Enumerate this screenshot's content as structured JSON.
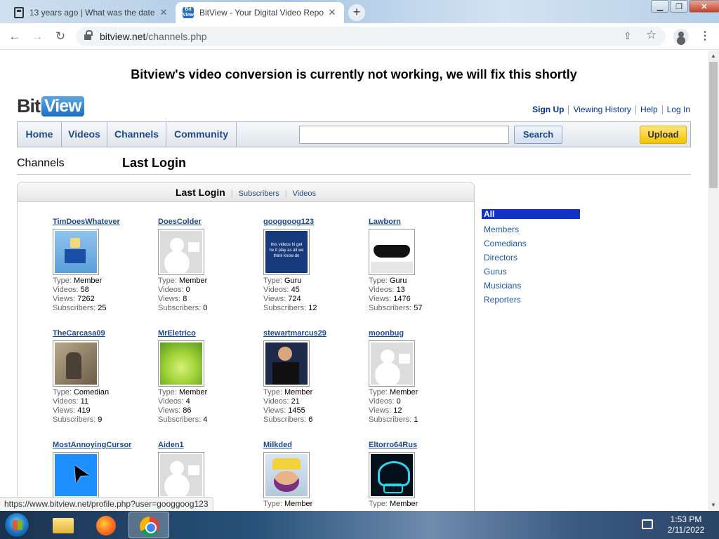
{
  "browser": {
    "tabs": [
      {
        "title": "13 years ago | What was the date"
      },
      {
        "title": "BitView - Your Digital Video Repo"
      }
    ],
    "url_host": "bitview.net",
    "url_path": "/channels.php",
    "status_url": "https://www.bitview.net/profile.php?user=googgoog123"
  },
  "page": {
    "banner": "Bitview's video conversion is currently not working, we will fix this shortly",
    "logo": {
      "part1": "Bit",
      "part2": "View"
    },
    "user_links": [
      "Sign Up",
      "Viewing History",
      "Help",
      "Log In"
    ],
    "nav": [
      "Home",
      "Videos",
      "Channels",
      "Community"
    ],
    "search": {
      "value": "",
      "button": "Search"
    },
    "upload": "Upload",
    "section": {
      "left": "Channels",
      "right": "Last Login"
    },
    "panel_tabs": {
      "active": "Last Login",
      "others": [
        "Subscribers",
        "Videos"
      ]
    },
    "labels": {
      "type": "Type:",
      "videos": "Videos:",
      "views": "Views:",
      "subscribers": "Subscribers:"
    },
    "channels": [
      {
        "name": "TimDoesWhatever",
        "thumb": "t-roblox",
        "type": "Member",
        "videos": "58",
        "views": "7262",
        "subscribers": "25"
      },
      {
        "name": "DoesColder",
        "thumb": "t-default",
        "type": "Member",
        "videos": "0",
        "views": "8",
        "subscribers": "0"
      },
      {
        "name": "googgoog123",
        "thumb": "t-text",
        "thumb_text": "this videos hi get he it play as all we think know do",
        "type": "Guru",
        "videos": "45",
        "views": "724",
        "subscribers": "12"
      },
      {
        "name": "Lawborn",
        "thumb": "t-glasses",
        "type": "Guru",
        "videos": "13",
        "views": "1476",
        "subscribers": "57"
      },
      {
        "name": "TheCarcasa09",
        "thumb": "t-soldier",
        "type": "Comedian",
        "videos": "11",
        "views": "419",
        "subscribers": "9"
      },
      {
        "name": "MrEletrico",
        "thumb": "t-green",
        "type": "Member",
        "videos": "4",
        "views": "86",
        "subscribers": "4"
      },
      {
        "name": "stewartmarcus29",
        "thumb": "t-wrestler",
        "type": "Member",
        "videos": "21",
        "views": "1455",
        "subscribers": "6"
      },
      {
        "name": "moonbug",
        "thumb": "t-default",
        "type": "Member",
        "videos": "0",
        "views": "12",
        "subscribers": "1"
      },
      {
        "name": "MostAnnoyingCursor",
        "thumb": "t-cursor",
        "type": "",
        "videos": "",
        "views": "",
        "subscribers": ""
      },
      {
        "name": "Aiden1",
        "thumb": "t-default",
        "type": "",
        "videos": "",
        "views": "",
        "subscribers": ""
      },
      {
        "name": "Milkded",
        "thumb": "t-wario",
        "type": "Member",
        "videos": "",
        "views": "",
        "subscribers": ""
      },
      {
        "name": "Eltorro64Rus",
        "thumb": "t-neon",
        "type": "Member",
        "videos": "",
        "views": "",
        "subscribers": ""
      }
    ],
    "filters": [
      "All",
      "Members",
      "Comedians",
      "Directors",
      "Gurus",
      "Musicians",
      "Reporters"
    ],
    "active_filter": "All"
  },
  "taskbar": {
    "time": "1:53 PM",
    "date": "2/11/2022"
  }
}
